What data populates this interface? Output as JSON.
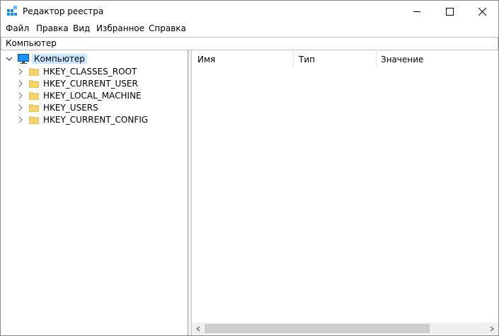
{
  "window": {
    "title": "Редактор реестра"
  },
  "menu": [
    "Файл",
    "Правка",
    "Вид",
    "Избранное",
    "Справка"
  ],
  "address": "Компьютер",
  "tree": {
    "root": "Компьютер",
    "children": [
      "HKEY_CLASSES_ROOT",
      "HKEY_CURRENT_USER",
      "HKEY_LOCAL_MACHINE",
      "HKEY_USERS",
      "HKEY_CURRENT_CONFIG"
    ]
  },
  "list": {
    "columns": [
      "Имя",
      "Тип",
      "Значение"
    ]
  },
  "colors": {
    "selection": "#cce8ff",
    "folder": "#f7d46b",
    "monitor": "#1e90ff"
  },
  "icons": [
    "registry-editor-icon",
    "computer-icon",
    "folder-icon",
    "chevron-right-icon",
    "chevron-down-icon",
    "minimize-icon",
    "maximize-icon",
    "close-icon"
  ]
}
